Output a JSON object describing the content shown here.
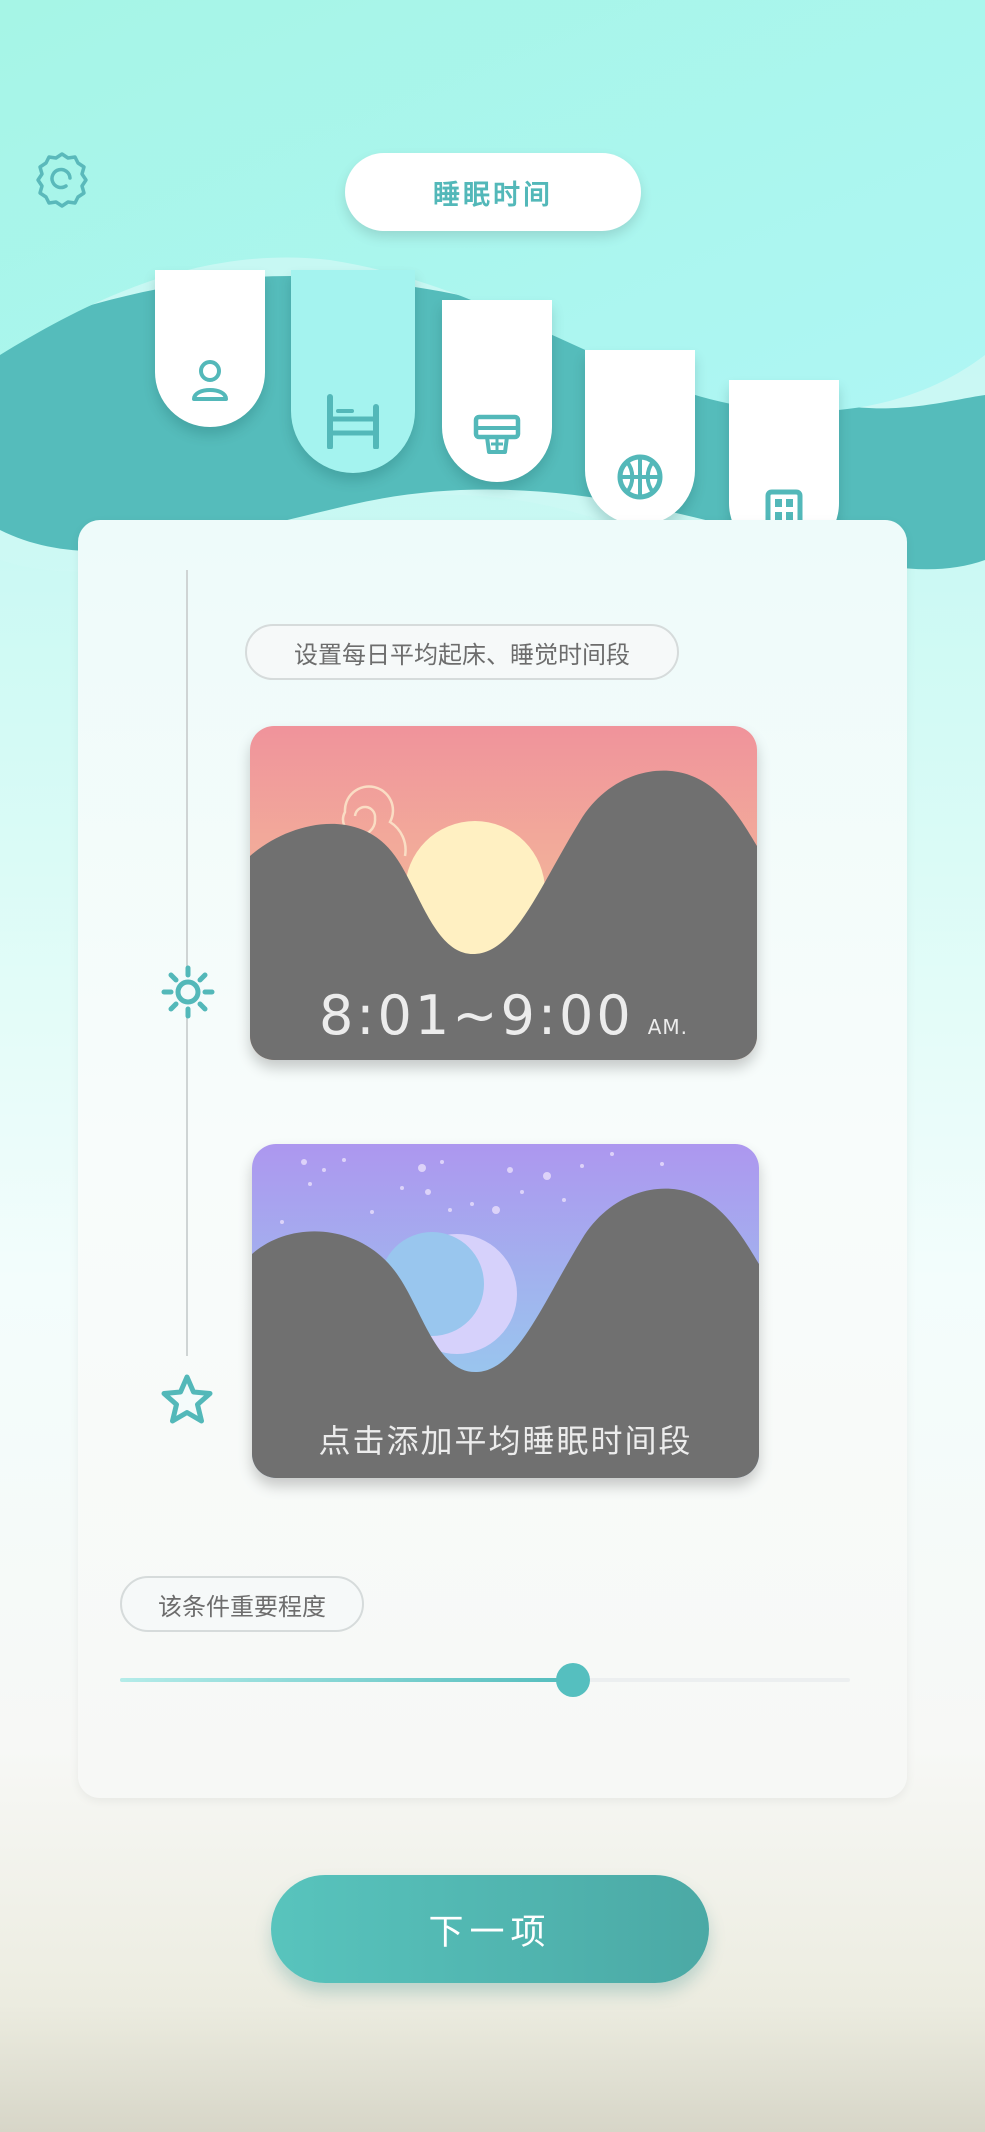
{
  "header": {
    "title": "睡眠时间"
  },
  "tabs": [
    {
      "name": "profile",
      "icon": "person-icon",
      "active": false
    },
    {
      "name": "sleep",
      "icon": "bed-icon",
      "active": true
    },
    {
      "name": "study",
      "icon": "desk-icon",
      "active": false
    },
    {
      "name": "sports",
      "icon": "basketball-icon",
      "active": false
    },
    {
      "name": "dorm",
      "icon": "building-icon",
      "active": false
    }
  ],
  "main": {
    "hint": "设置每日平均起床、睡觉时间段",
    "wake_card": {
      "time": "8:01~9:00",
      "ampm": "AM."
    },
    "sleep_card": {
      "prompt": "点击添加平均睡眠时间段"
    },
    "importance": {
      "label": "该条件重要程度",
      "value": 0.62
    }
  },
  "footer": {
    "next_label": "下一项"
  },
  "colors": {
    "accent": "#53b8b9",
    "wave_light": "#a6f4ef",
    "wave_dark": "#55bcbb",
    "mountain": "#707070"
  }
}
